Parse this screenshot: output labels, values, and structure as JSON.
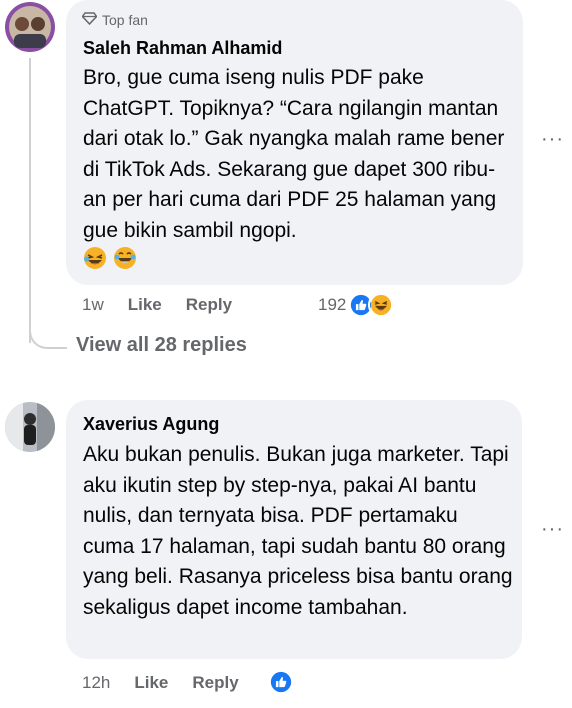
{
  "comment1": {
    "badge": "Top fan",
    "author": "Saleh Rahman Alhamid",
    "text": "Bro, gue cuma iseng nulis PDF pake ChatGPT. Topiknya? “Cara ngilangin mantan dari otak lo.” Gak nyangka malah rame bener di TikTok Ads. Sekarang gue dapet 300 ribu-an per hari cuma dari PDF 25 halaman yang gue bikin sambil ngopi.",
    "emojis": [
      "laughing-face-emoji",
      "laughing-face-emoji"
    ],
    "time": "1w",
    "like_label": "Like",
    "reply_label": "Reply",
    "reaction_count": "192",
    "reaction_icons": [
      "like-icon",
      "haha-icon"
    ],
    "more_label": "···"
  },
  "view_replies_label": "View all 28 replies",
  "comment2": {
    "author": "Xaverius Agung",
    "text": "Aku bukan penulis. Bukan juga marketer. Tapi aku ikutin step by step-nya, pakai AI bantu nulis, dan ternyata bisa. PDF pertamaku cuma 17 halaman, tapi sudah bantu 80 orang yang beli. Rasanya priceless bisa bantu orang sekaligus dapet income tambahan.",
    "time": "12h",
    "like_label": "Like",
    "reply_label": "Reply",
    "reaction_icons": [
      "like-icon"
    ],
    "more_label": "···"
  },
  "colors": {
    "bubble": "#f0f2f5",
    "meta_text": "#65676b",
    "like_blue": "#1877f2",
    "haha_yellow": "#f7b125"
  }
}
